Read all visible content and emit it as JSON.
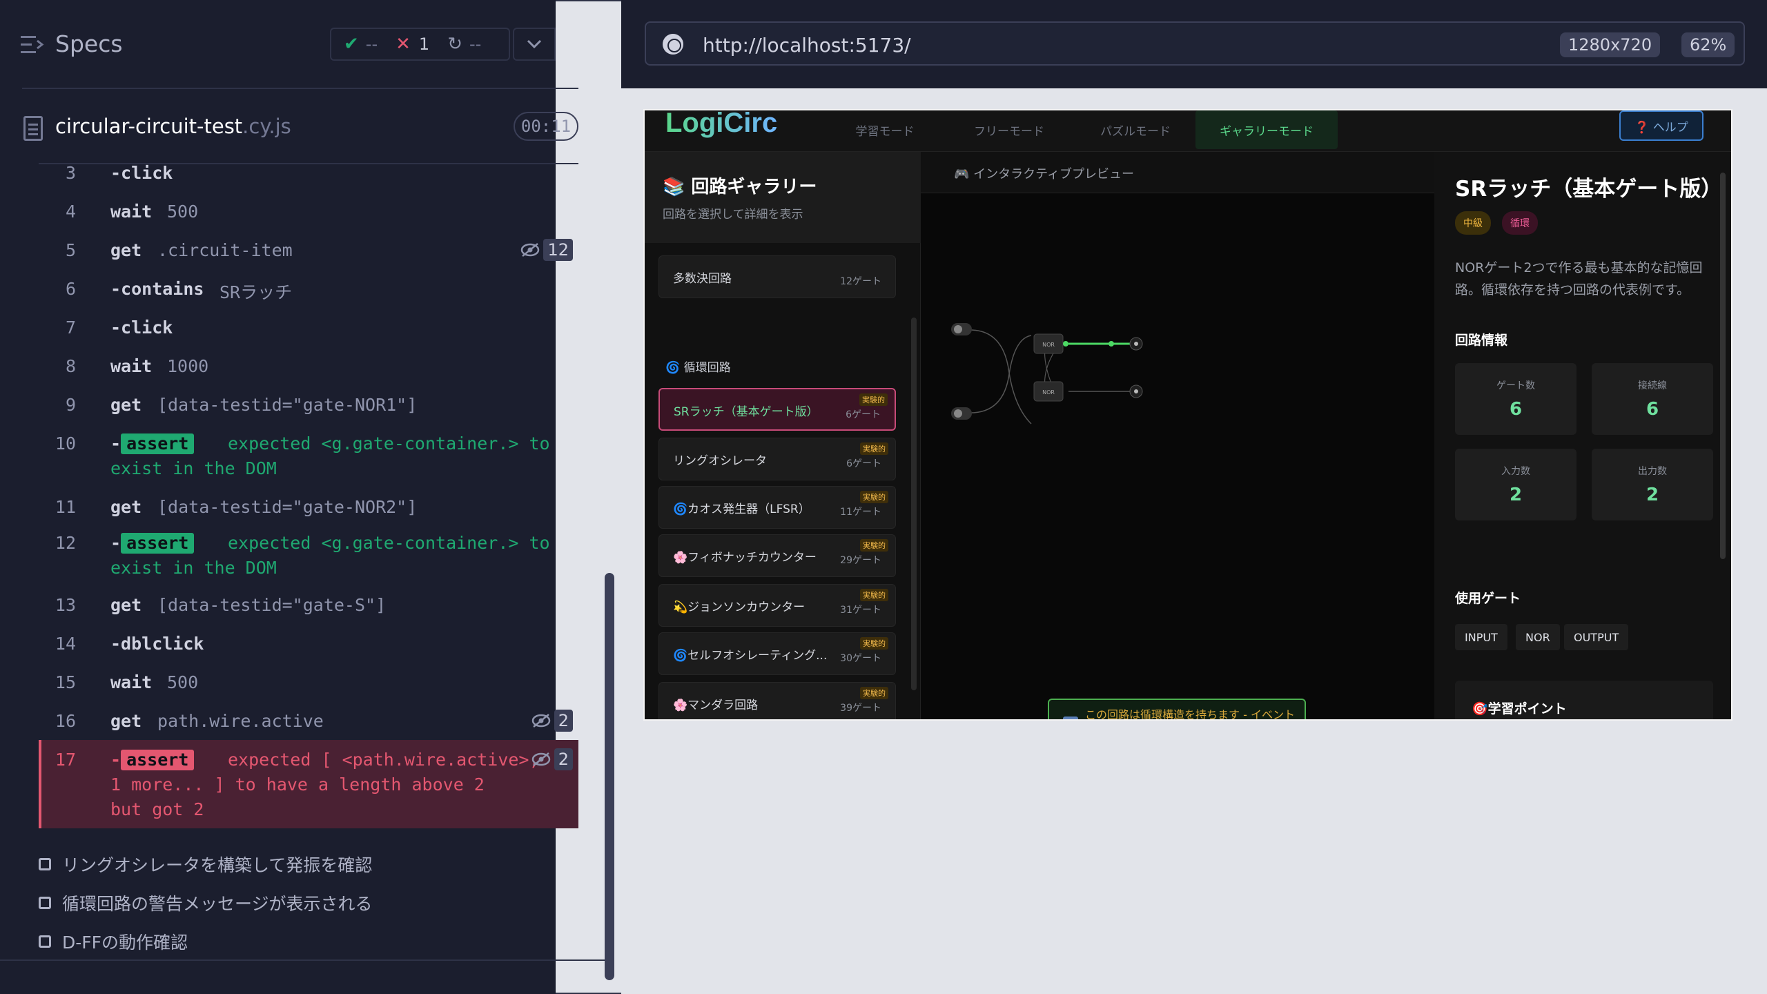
{
  "reporter": {
    "title": "Specs",
    "stats": {
      "passed": "--",
      "failed": "1",
      "pending": "--"
    },
    "spec_file": {
      "name": "circular-circuit-test",
      "ext": ".cy.js"
    },
    "timer": "00:11",
    "commands": [
      {
        "num": "3",
        "name": "-click",
        "msg": ""
      },
      {
        "num": "4",
        "name": "wait",
        "msg": "500"
      },
      {
        "num": "5",
        "name": "get",
        "msg": ".circuit-item",
        "count": "12"
      },
      {
        "num": "6",
        "name": "-contains",
        "msg": "SRラッチ"
      },
      {
        "num": "7",
        "name": "-click",
        "msg": ""
      },
      {
        "num": "8",
        "name": "wait",
        "msg": "1000"
      },
      {
        "num": "9",
        "name": "get",
        "msg": "[data-testid=\"gate-NOR1\"]"
      },
      {
        "num": "10",
        "name": "assert",
        "line1": "expected <g.gate-container.> to",
        "line2": "exist in the DOM"
      },
      {
        "num": "11",
        "name": "get",
        "msg": "[data-testid=\"gate-NOR2\"]"
      },
      {
        "num": "12",
        "name": "assert",
        "line1": "expected <g.gate-container.> to",
        "line2": "exist in the DOM"
      },
      {
        "num": "13",
        "name": "get",
        "msg": "[data-testid=\"gate-S\"]"
      },
      {
        "num": "14",
        "name": "-dblclick",
        "msg": ""
      },
      {
        "num": "15",
        "name": "wait",
        "msg": "500"
      },
      {
        "num": "16",
        "name": "get",
        "msg": "path.wire.active",
        "count": "2"
      },
      {
        "num": "17",
        "name": "assert",
        "line1": "expected [ <path.wire.active>,",
        "line2": "1 more... ] to have a length above 2",
        "line3": "but got 2",
        "count": "2"
      }
    ],
    "todos": [
      "リングオシレータを構築して発振を確認",
      "循環回路の警告メッセージが表示される",
      "D-FFの動作確認"
    ]
  },
  "browser": {
    "url": "http://localhost:5173/",
    "viewport": "1280x720",
    "zoom": "62%"
  },
  "app": {
    "logo": "LogiCirc",
    "tabs": [
      "学習モード",
      "フリーモード",
      "パズルモード",
      "ギャラリーモード"
    ],
    "help": "❓ ヘルプ",
    "gallery": {
      "title": "📚 回路ギャラリー",
      "subtitle": "回路を選択して詳細を表示",
      "section": "🌀 循環回路",
      "tag": "実験的",
      "items": [
        {
          "name": "多数決回路",
          "count": "12ゲート"
        },
        {
          "name": "SRラッチ（基本ゲート版）",
          "count": "6ゲート"
        },
        {
          "name": "リングオシレータ",
          "count": "6ゲート"
        },
        {
          "name": "🌀カオス発生器（LFSR）",
          "count": "11ゲート"
        },
        {
          "name": "🌸フィボナッチカウンター",
          "count": "29ゲート"
        },
        {
          "name": "💫ジョンソンカウンター",
          "count": "31ゲート"
        },
        {
          "name": "🌀セルフオシレーティング...",
          "count": "30ゲート"
        },
        {
          "name": "🌸マンダラ回路",
          "count": "39ゲート"
        }
      ]
    },
    "preview": {
      "title": "🎮 インタラクティブプレビュー",
      "notice_icon": "ℹ",
      "notice": "この回路は循環構造を持ちます - イベント駆動シミュレーションで動作中"
    },
    "detail": {
      "title": "SRラッチ（基本ゲート版）",
      "level": "中級",
      "category": "循環",
      "description": "NORゲート2つで作る最も基本的な記憶回路。循環依存を持つ回路の代表例です。",
      "info_heading": "回路情報",
      "stats": [
        {
          "label": "ゲート数",
          "value": "6"
        },
        {
          "label": "接続線",
          "value": "6"
        },
        {
          "label": "入力数",
          "value": "2"
        },
        {
          "label": "出力数",
          "value": "2"
        }
      ],
      "gates_heading": "使用ゲート",
      "gates": [
        "INPUT",
        "NOR",
        "OUTPUT"
      ],
      "learning": "🎯学習ポイント"
    }
  }
}
